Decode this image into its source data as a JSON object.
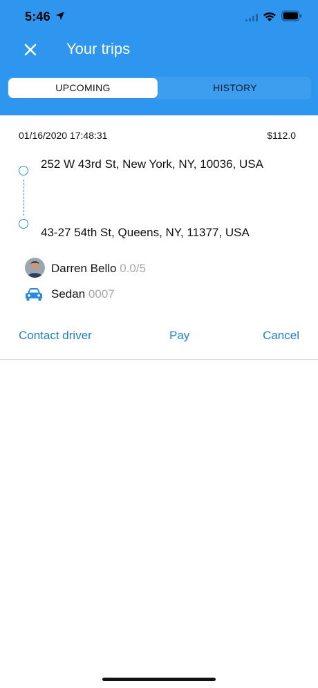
{
  "status_bar": {
    "time": "5:46"
  },
  "header": {
    "title": "Your trips",
    "tabs": [
      {
        "label": "UPCOMING",
        "selected": true
      },
      {
        "label": "HISTORY",
        "selected": false
      }
    ],
    "background_color": "#2f96f0"
  },
  "trip": {
    "datetime": "01/16/2020 17:48:31",
    "price": "$112.0",
    "pickup": "252 W 43rd St, New York, NY, 10036, USA",
    "dropoff": "43-27 54th St, Queens, NY, 11377, USA",
    "driver": {
      "name": "Darren Bello",
      "rating": "0.0/5"
    },
    "vehicle": {
      "type": "Sedan",
      "plate": "0007",
      "icon": "car-icon"
    },
    "actions": {
      "contact": "Contact driver",
      "pay": "Pay",
      "cancel": "Cancel"
    }
  },
  "colors": {
    "accent": "#1f7fd0",
    "route": "#2a8bdc",
    "muted": "#a8a8a8"
  }
}
